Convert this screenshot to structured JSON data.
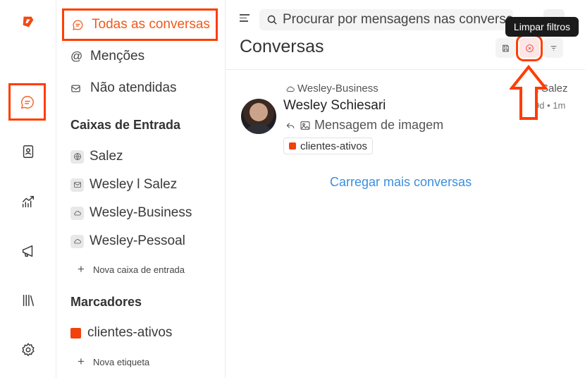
{
  "rail": {
    "items": [
      {
        "name": "logo-icon"
      },
      {
        "name": "conversations-icon",
        "active": true
      },
      {
        "name": "contacts-icon"
      },
      {
        "name": "reports-icon"
      },
      {
        "name": "campaigns-icon"
      },
      {
        "name": "library-icon"
      },
      {
        "name": "settings-icon"
      }
    ]
  },
  "sidebar": {
    "nav": {
      "all": "Todas as conversas",
      "mentions": "Menções",
      "unattended": "Não atendidas"
    },
    "inboxes_title": "Caixas de Entrada",
    "inboxes": [
      {
        "label": "Salez",
        "icon": "globe-icon"
      },
      {
        "label": "Wesley l Salez",
        "icon": "mail-icon"
      },
      {
        "label": "Wesley-Business",
        "icon": "cloud-icon"
      },
      {
        "label": "Wesley-Pessoal",
        "icon": "cloud-icon"
      }
    ],
    "add_inbox": "Nova caixa de entrada",
    "labels_title": "Marcadores",
    "labels": [
      {
        "label": "clientes-ativos",
        "color": "#f2410d"
      }
    ],
    "add_label": "Nova etiqueta"
  },
  "main": {
    "search": {
      "placeholder": "Procurar por mensagens nas conversas"
    },
    "title": "Conversas",
    "tooltip": "Limpar filtros",
    "conversation": {
      "inbox": "Wesley-Business",
      "assignee": "Salez",
      "contact": "Wesley Schiesari",
      "last_message": "Mensagem de imagem",
      "time": "9d • 1m",
      "tag": "clientes-ativos",
      "tag_color": "#f2410d"
    },
    "load_more": "Carregar mais conversas"
  },
  "colors": {
    "accent": "#f05a1a",
    "highlight": "#ff3d00",
    "link": "#3b8ee0"
  }
}
